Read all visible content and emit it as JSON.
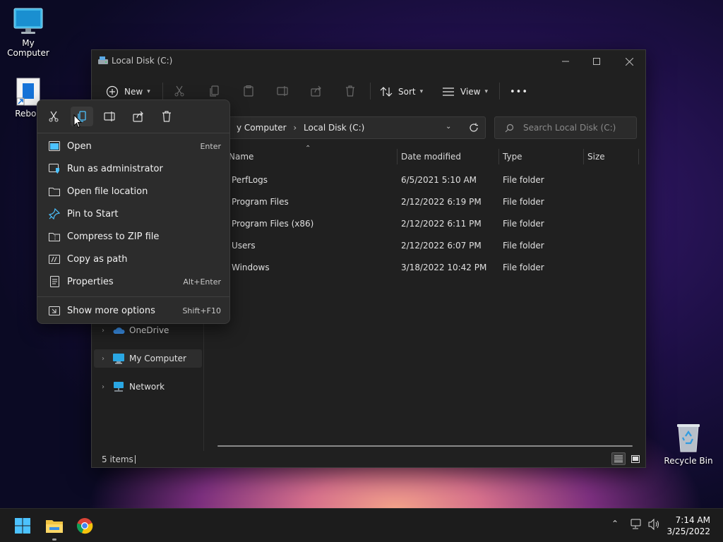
{
  "desktop": {
    "icons": [
      {
        "label": "My Computer"
      },
      {
        "label": "Reboo"
      },
      {
        "label": "Recycle Bin"
      }
    ]
  },
  "window": {
    "title": "Local Disk (C:)",
    "toolbar": {
      "new_label": "New",
      "sort_label": "Sort",
      "view_label": "View",
      "more_label": "•••"
    },
    "address": {
      "crumb_parent": "y Computer",
      "crumb_sep": "›",
      "crumb_current": "Local Disk (C:)"
    },
    "search": {
      "placeholder": "Search Local Disk (C:)"
    },
    "columns": {
      "name": "Name",
      "date": "Date modified",
      "type": "Type",
      "size": "Size"
    },
    "files": [
      {
        "name": "PerfLogs",
        "date": "6/5/2021 5:10 AM",
        "type": "File folder"
      },
      {
        "name": "Program Files",
        "date": "2/12/2022 6:19 PM",
        "type": "File folder"
      },
      {
        "name": "Program Files (x86)",
        "date": "2/12/2022 6:11 PM",
        "type": "File folder"
      },
      {
        "name": "Users",
        "date": "2/12/2022 6:07 PM",
        "type": "File folder"
      },
      {
        "name": "Windows",
        "date": "3/18/2022 10:42 PM",
        "type": "File folder"
      }
    ],
    "nav": [
      {
        "label": "OneDrive",
        "icon": "cloud-icon"
      },
      {
        "label": "My Computer",
        "icon": "computer-icon"
      },
      {
        "label": "Network",
        "icon": "network-icon"
      }
    ],
    "status": {
      "items": "5 items"
    }
  },
  "context_menu": {
    "quick_actions": [
      "cut-icon",
      "copy-icon",
      "rename-icon",
      "share-icon",
      "delete-icon"
    ],
    "items": [
      {
        "label": "Open",
        "shortcut": "Enter"
      },
      {
        "label": "Run as administrator",
        "shortcut": ""
      },
      {
        "label": "Open file location",
        "shortcut": ""
      },
      {
        "label": "Pin to Start",
        "shortcut": ""
      },
      {
        "label": "Compress to ZIP file",
        "shortcut": ""
      },
      {
        "label": "Copy as path",
        "shortcut": ""
      },
      {
        "label": "Properties",
        "shortcut": "Alt+Enter"
      },
      {
        "label": "Show more options",
        "shortcut": "Shift+F10"
      }
    ]
  },
  "taskbar": {
    "time": "7:14 AM",
    "date": "3/25/2022"
  },
  "colors": {
    "accent": "#4cc2ff",
    "window_bg": "#202020",
    "menu_bg": "#2c2c2c"
  }
}
